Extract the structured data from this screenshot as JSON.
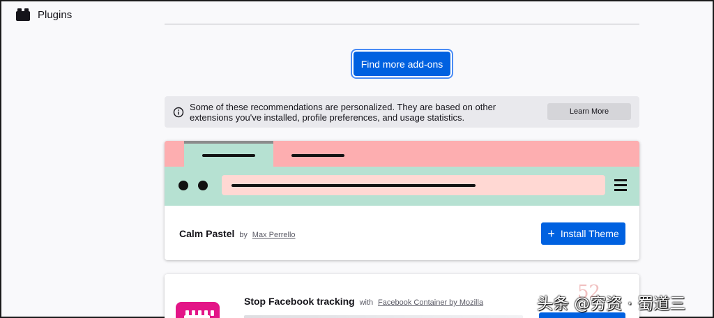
{
  "sidebar": {
    "plugins_label": "Plugins",
    "plugins_icon": "plugin-icon"
  },
  "main": {
    "find_more_label": "Find more add-ons",
    "notice": {
      "icon": "info-icon",
      "text": "Some of these recommendations are personalized. They are based on other extensions you've installed, profile preferences, and usage statistics.",
      "learn_more_label": "Learn More"
    },
    "theme_card": {
      "name": "Calm Pastel",
      "by": "by",
      "author": "Max Perrello",
      "install_label": "Install Theme",
      "colors": {
        "tab_bar": "#fdaeb0",
        "toolbar": "#b6e1d2",
        "url_bar": "#ffd8d3"
      }
    },
    "extension_card": {
      "title": "Stop Facebook tracking",
      "with": "with",
      "link": "Facebook Container by Mozilla"
    }
  },
  "watermark": {
    "text": "头条 @穷资 · 蜀道三",
    "faint": "52"
  },
  "colors": {
    "accent": "#0061e0",
    "background": "#f9f9fb"
  }
}
